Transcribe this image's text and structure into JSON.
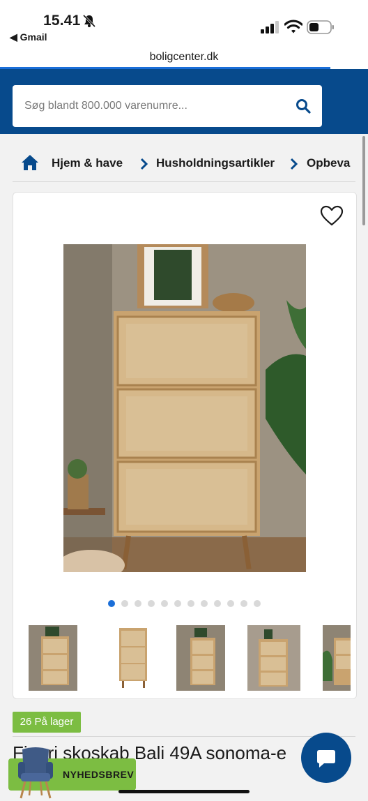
{
  "status_bar": {
    "time": "15.41",
    "back_app": "◀ Gmail",
    "url": "boligcenter.dk"
  },
  "search": {
    "placeholder": "Søg blandt 800.000 varenumre..."
  },
  "breadcrumb": {
    "items": [
      "Hjem & have",
      "Husholdningsartikler",
      "Opbeva"
    ]
  },
  "product": {
    "stock_badge": "26 På lager",
    "title": "Finori skoskab Bali 49A sonoma-e",
    "image_count": 12,
    "active_image": 1
  },
  "newsletter": {
    "label": "NYHEDSBREV"
  },
  "icons": {
    "home": "home-icon",
    "search": "search-icon",
    "heart": "heart-icon",
    "chat": "chat-icon"
  },
  "colors": {
    "brand_blue": "#074a8c",
    "accent_green": "#7cbd42",
    "active_dot": "#1a6ed8"
  }
}
